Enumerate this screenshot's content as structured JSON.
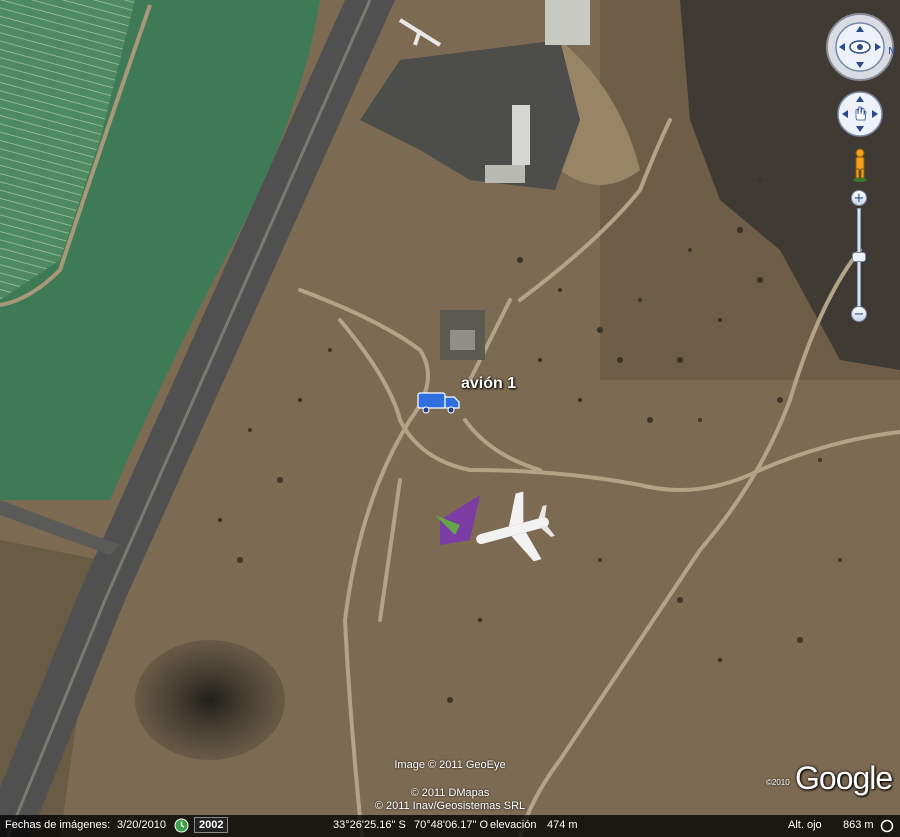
{
  "placemark": {
    "label": "avión 1",
    "icon": "truck-icon"
  },
  "credits": {
    "line1": "Image © 2011 GeoEye",
    "line2": "© 2011 DMapas",
    "line3": "© 2011 Inav/Geosistemas SRL"
  },
  "logo": {
    "text": "Google",
    "year": "©2010"
  },
  "statusbar": {
    "imagery_label": "Fechas de imágenes:",
    "imagery_date": "3/20/2010",
    "history_year": "2002",
    "lat": "33°26'25.16\" S",
    "lon": "70°48'06.17\" O",
    "elevation_label": "elevación",
    "elevation_value": "474 m",
    "eye_label": "Alt. ojo",
    "eye_value": "863 m"
  },
  "controls": {
    "look": "look-around-control",
    "move": "move-control",
    "pegman": "street-view-pegman-icon",
    "zoom_in": "+",
    "zoom_out": "−"
  },
  "colors": {
    "terrain": "#7d6a52",
    "field_green": "#3e7a55",
    "highway": "#4a4a4a",
    "placemark_blue": "#2f6fe0"
  }
}
